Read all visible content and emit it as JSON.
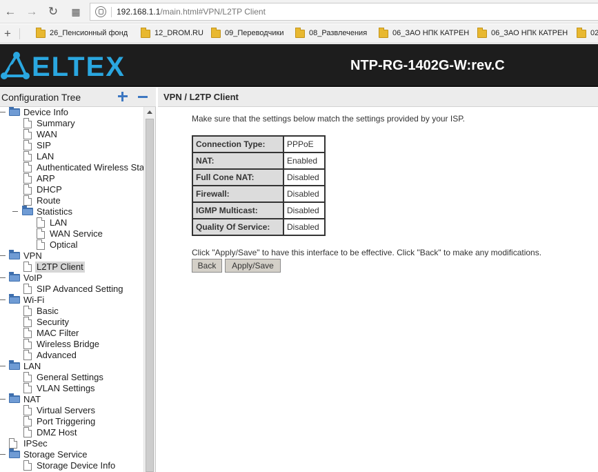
{
  "browser": {
    "url_host": "192.168.1.1",
    "url_path": "/main.html#VPN/L2TP Client",
    "bookmarks": [
      "26_Пенсионный фонд",
      "12_DROM.RU",
      "09_Переводчики",
      "08_Развлечения",
      "06_ЗАО НПК КАТРЕН",
      "06_ЗАО НПК КАТРЕН",
      "02"
    ]
  },
  "header": {
    "logo_text": "ELTEX",
    "model": "NTP-RG-1402G-W:rev.C",
    "colors": {
      "header_bg": "#1d1d1d",
      "logo": "#2aa7e0"
    }
  },
  "sidebar": {
    "title": "Configuration Tree",
    "tree": [
      "Device Info",
      "Summary",
      "WAN",
      "SIP",
      "LAN",
      "Authenticated Wireless Stations",
      "ARP",
      "DHCP",
      "Route",
      "Statistics",
      "LAN",
      "WAN Service",
      "Optical",
      "VPN",
      "L2TP Client",
      "VoIP",
      "SIP Advanced Setting",
      "Wi-Fi",
      "Basic",
      "Security",
      "MAC Filter",
      "Wireless Bridge",
      "Advanced",
      "LAN",
      "General Settings",
      "VLAN Settings",
      "NAT",
      "Virtual Servers",
      "Port Triggering",
      "DMZ Host",
      "IPSec",
      "Storage Service",
      "Storage Device Info"
    ]
  },
  "main": {
    "title": "VPN / L2TP Client",
    "intro": "Make sure that the settings below match the settings provided by your ISP.",
    "rows": [
      {
        "label": "Connection Type:",
        "value": "PPPoE"
      },
      {
        "label": "NAT:",
        "value": "Enabled"
      },
      {
        "label": "Full Cone NAT:",
        "value": "Disabled"
      },
      {
        "label": "Firewall:",
        "value": "Disabled"
      },
      {
        "label": "IGMP Multicast:",
        "value": "Disabled"
      },
      {
        "label": "Quality Of Service:",
        "value": "Disabled"
      }
    ],
    "hint": "Click \"Apply/Save\" to have this interface to be effective. Click \"Back\" to make any modifications.",
    "back_label": "Back",
    "apply_label": "Apply/Save"
  }
}
